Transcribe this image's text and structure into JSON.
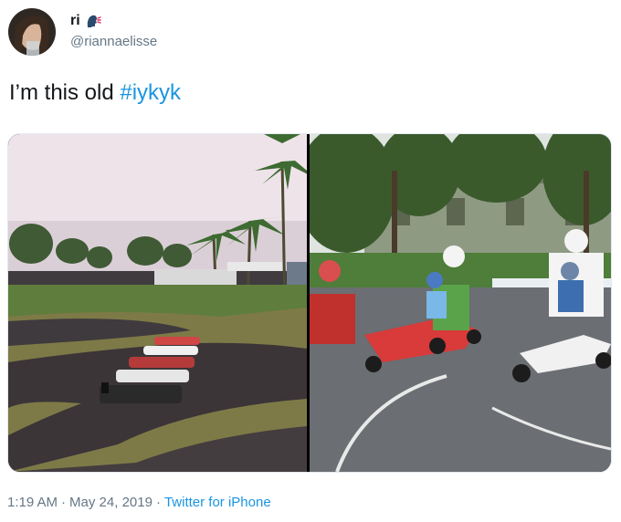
{
  "author": {
    "display_name": "ri",
    "handle": "@riannaelisse",
    "badge_icon": "speaking-head-emoji-icon"
  },
  "tweet": {
    "text_prefix": "I’m this old ",
    "hashtag": "#iykyk"
  },
  "media": {
    "photos": [
      {
        "subject": "go-kart-track-photo"
      },
      {
        "subject": "adults-racing-go-karts-photo"
      }
    ]
  },
  "meta": {
    "time": "1:19 AM",
    "separator": "·",
    "date": "May 24, 2019",
    "source": "Twitter for iPhone"
  },
  "colors": {
    "link": "#1b95e0",
    "secondary_text": "#657786",
    "primary_text": "#14171a"
  }
}
